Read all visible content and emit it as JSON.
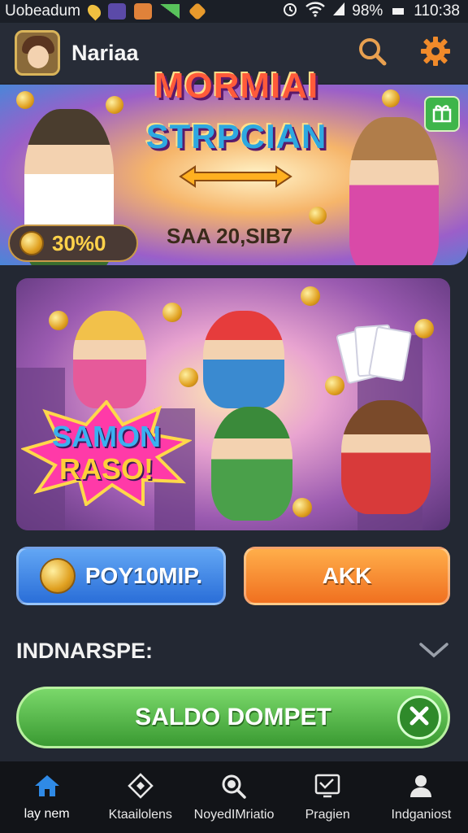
{
  "status_bar": {
    "carrier": "Uobeadum",
    "battery": "98%",
    "time": "110:38"
  },
  "header": {
    "title": "Nariaa",
    "icons": [
      "search-icon",
      "settings-gear-icon"
    ]
  },
  "banner": {
    "title_line1": "MORMIAI",
    "title_line2": "STRPCIAN",
    "subtitle": "SAA 20,SIB7",
    "coin_amount": "30%0"
  },
  "promo": {
    "burst_line1": "SAMON",
    "burst_line2": "RASO!"
  },
  "buttons": {
    "primary_label": "POY10MIP.",
    "secondary_label": "AKK"
  },
  "section": {
    "title": "INDNARSPE:"
  },
  "wallet": {
    "label": "SALDO DOMPET"
  },
  "bottom_nav": {
    "items": [
      {
        "label": "lay nem",
        "icon": "home-icon"
      },
      {
        "label": "Ktaailolens",
        "icon": "diamond-icon"
      },
      {
        "label": "NoyedIMriatio",
        "icon": "search-icon"
      },
      {
        "label": "Pragien",
        "icon": "chart-icon"
      },
      {
        "label": "Indganiost",
        "icon": "profile-icon"
      }
    ]
  },
  "colors": {
    "background": "#232833",
    "nav_active": "#2f8ae6",
    "wallet_green": "#4cb23e",
    "primary_blue": "#3a82e4",
    "secondary_orange": "#f5862e"
  }
}
